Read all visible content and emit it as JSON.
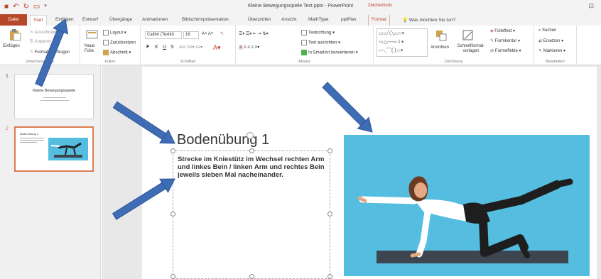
{
  "titlebar": {
    "title": "Kleine Bewegungsspiele Test.pptx - PowerPoint",
    "contextual": "Zeichentools"
  },
  "tabs": [
    "Datei",
    "Start",
    "Einfügen",
    "Entwurf",
    "Übergänge",
    "Animationen",
    "Bildschirmpräsentation",
    "Überprüfen",
    "Ansicht",
    "MathType",
    "pptPlex",
    "Format"
  ],
  "tell_me": "Was möchten Sie tun?",
  "ribbon": {
    "clipboard": {
      "paste": "Einfügen",
      "cut": "Ausschneiden",
      "copy": "Kopieren",
      "painter": "Format übertragen",
      "label": "Zwischenablage"
    },
    "slides": {
      "new": "Neue Folie",
      "layout": "Layout",
      "reset": "Zurücksetzen",
      "section": "Abschnitt",
      "label": "Folien"
    },
    "font": {
      "name": "Calibri (Textkö",
      "size": "16",
      "label": "Schriftart",
      "bold": "F",
      "italic": "K",
      "underline": "U",
      "strike": "S"
    },
    "paragraph": {
      "direction": "Textrichtung",
      "align": "Text ausrichten",
      "smartart": "In SmartArt konvertieren",
      "label": "Absatz"
    },
    "drawing": {
      "arrange": "Anordnen",
      "quickstyles": "Schnellformat-vorlagen",
      "fill": "Fülleffekt",
      "outline": "Formkontur",
      "effects": "Formeffekte",
      "label": "Zeichnung"
    },
    "editing": {
      "find": "Suchen",
      "replace": "Ersetzen",
      "select": "Markieren",
      "label": "Bearbeiten"
    }
  },
  "slides_panel": {
    "slide1": {
      "num": "1",
      "title": "Kleine Bewegungsspiele"
    },
    "slide2": {
      "num": "2",
      "title": "Bodenübung 1"
    }
  },
  "slide": {
    "title": "Bodenübung 1",
    "body": "Strecke im Kniestütz im Wechsel rechten Arm und linkes Bein / linken Arm und rechtes Bein jeweils sieben Mal nacheinander."
  },
  "colors": {
    "accent": "#b7472a",
    "arrow": "#3e6db5",
    "picture_bg": "#55bde0",
    "mat": "#3c4550",
    "selected_thumb": "#e07a50"
  }
}
